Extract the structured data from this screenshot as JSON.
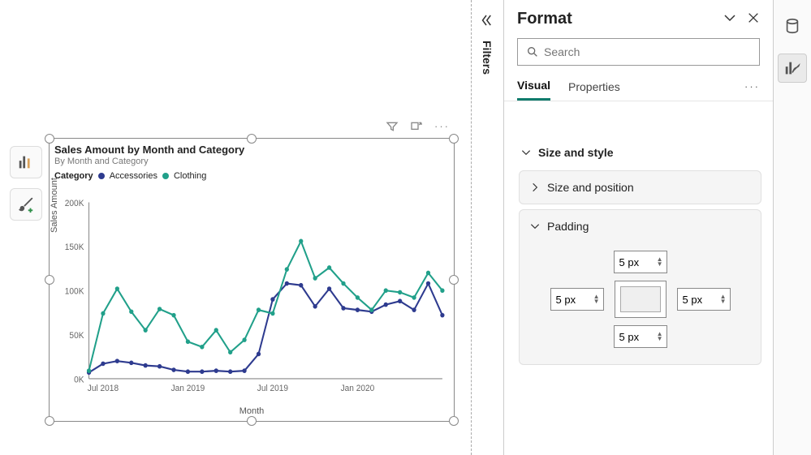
{
  "chart_data": {
    "type": "line",
    "title": "Sales Amount by Month and Category",
    "subtitle": "By Month and Category",
    "xlabel": "Month",
    "ylabel": "Sales Amount",
    "ylim": [
      0,
      200000
    ],
    "y_ticks": [
      "0K",
      "50K",
      "100K",
      "150K",
      "200K"
    ],
    "x_ticks": [
      "Jul 2018",
      "Jan 2019",
      "Jul 2019",
      "Jan 2020"
    ],
    "legend_title": "Category",
    "series": [
      {
        "name": "Accessories",
        "color": "#2e3b8f",
        "values": [
          7000,
          17000,
          20000,
          18000,
          15000,
          14000,
          10000,
          8000,
          8000,
          9000,
          8000,
          9000,
          28000,
          90000,
          108000,
          106000,
          82000,
          102000,
          80000,
          78000,
          76000,
          84000,
          88000,
          78000,
          108000,
          72000
        ]
      },
      {
        "name": "Clothing",
        "color": "#21a08a",
        "values": [
          9000,
          74000,
          102000,
          76000,
          55000,
          79000,
          72000,
          42000,
          36000,
          55000,
          30000,
          44000,
          78000,
          74000,
          124000,
          156000,
          114000,
          126000,
          108000,
          92000,
          78000,
          100000,
          98000,
          92000,
          120000,
          100000
        ]
      }
    ]
  },
  "filters": {
    "label": "Filters"
  },
  "format": {
    "title": "Format",
    "search_placeholder": "Search",
    "tabs": {
      "visual": "Visual",
      "properties": "Properties"
    },
    "sections": {
      "size_style": "Size and style",
      "size_position": "Size and position",
      "padding": "Padding"
    },
    "padding": {
      "top": "5 px",
      "left": "5 px",
      "right": "5 px",
      "bottom": "5 px"
    }
  }
}
